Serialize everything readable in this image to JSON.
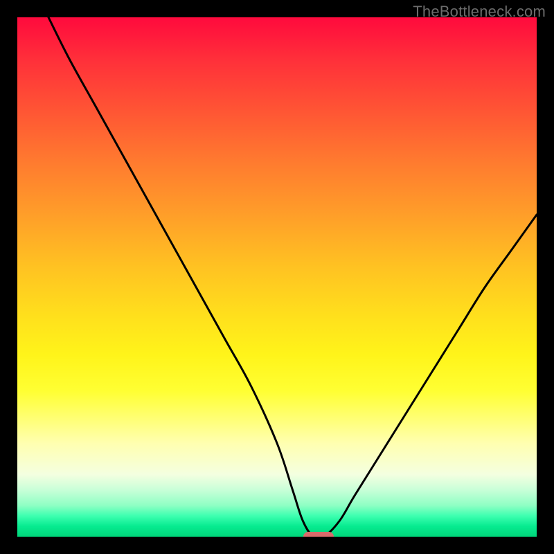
{
  "watermark": "TheBottleneck.com",
  "chart_data": {
    "type": "line",
    "title": "",
    "xlabel": "",
    "ylabel": "",
    "xlim": [
      0,
      100
    ],
    "ylim": [
      0,
      100
    ],
    "grid": false,
    "legend": false,
    "series": [
      {
        "name": "bottleneck-curve",
        "x": [
          6,
          10,
          15,
          20,
          25,
          30,
          35,
          40,
          45,
          50,
          53,
          55,
          57,
          59,
          62,
          65,
          70,
          75,
          80,
          85,
          90,
          95,
          100
        ],
        "y": [
          100,
          92,
          83,
          74,
          65,
          56,
          47,
          38,
          29,
          18,
          9,
          3,
          0,
          0,
          3,
          8,
          16,
          24,
          32,
          40,
          48,
          55,
          62
        ]
      }
    ],
    "optimal_point": {
      "x": 58,
      "y": 0
    },
    "gradient_stops": [
      {
        "pct": 0,
        "color": "#ff0a3d"
      },
      {
        "pct": 8,
        "color": "#ff2f3a"
      },
      {
        "pct": 18,
        "color": "#ff5534"
      },
      {
        "pct": 28,
        "color": "#ff7b2f"
      },
      {
        "pct": 38,
        "color": "#ff9e29"
      },
      {
        "pct": 48,
        "color": "#ffc222"
      },
      {
        "pct": 58,
        "color": "#ffe11c"
      },
      {
        "pct": 65,
        "color": "#fff41a"
      },
      {
        "pct": 72,
        "color": "#ffff33"
      },
      {
        "pct": 82,
        "color": "#ffffb0"
      },
      {
        "pct": 88,
        "color": "#f4ffe0"
      },
      {
        "pct": 91,
        "color": "#c8ffd8"
      },
      {
        "pct": 94,
        "color": "#8effc4"
      },
      {
        "pct": 96,
        "color": "#3dffb0"
      },
      {
        "pct": 98,
        "color": "#07eb90"
      },
      {
        "pct": 100,
        "color": "#00d67a"
      }
    ],
    "marker_color": "#d96b6b"
  }
}
